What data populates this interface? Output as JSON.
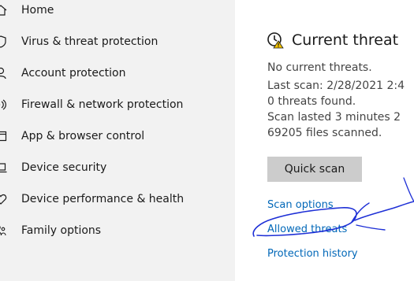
{
  "sidebar": {
    "items": [
      {
        "label": "Home",
        "icon": "home-icon"
      },
      {
        "label": "Virus & threat protection",
        "icon": "shield-icon"
      },
      {
        "label": "Account protection",
        "icon": "person-icon"
      },
      {
        "label": "Firewall & network protection",
        "icon": "wifi-icon"
      },
      {
        "label": "App & browser control",
        "icon": "app-window-icon"
      },
      {
        "label": "Device security",
        "icon": "laptop-icon"
      },
      {
        "label": "Device performance & health",
        "icon": "heart-icon"
      },
      {
        "label": "Family options",
        "icon": "family-icon"
      }
    ]
  },
  "main": {
    "title": "Current threat",
    "title_icon": "clock-warning-icon",
    "status_lines": [
      "No current threats.",
      "Last scan: 2/28/2021 2:4",
      "0 threats found.",
      "Scan lasted 3 minutes 2",
      "69205 files scanned."
    ],
    "quick_scan_label": "Quick scan",
    "links": [
      "Scan options",
      "Allowed threats",
      "Protection history"
    ]
  },
  "colors": {
    "sidebar_bg": "#f2f2f2",
    "link": "#0067b8",
    "button_bg": "#cccccc",
    "scribble": "#1d2fd6"
  }
}
